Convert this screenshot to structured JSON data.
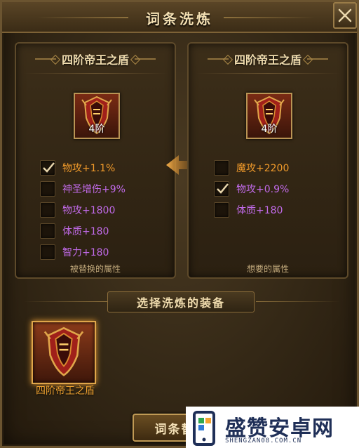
{
  "window": {
    "title": "词条洗炼"
  },
  "left_panel": {
    "title": "四阶帝王之盾",
    "item_level": "4阶",
    "attributes": [
      {
        "text": "物攻+1.1%",
        "color": "orange",
        "checked": true
      },
      {
        "text": "神圣增伤+9%",
        "color": "purple",
        "checked": false
      },
      {
        "text": "物攻+1800",
        "color": "purple",
        "checked": false
      },
      {
        "text": "体质+180",
        "color": "purple",
        "checked": false
      },
      {
        "text": "智力+180",
        "color": "purple",
        "checked": false
      }
    ],
    "footer": "被替换的属性"
  },
  "right_panel": {
    "title": "四阶帝王之盾",
    "item_level": "4阶",
    "attributes": [
      {
        "text": "魔攻+2200",
        "color": "orange",
        "checked": false
      },
      {
        "text": "物攻+0.9%",
        "color": "purple",
        "checked": true
      },
      {
        "text": "体质+180",
        "color": "purple",
        "checked": false
      }
    ],
    "footer": "想要的属性"
  },
  "select_section": {
    "title": "选择洗炼的装备",
    "equipment_name": "四阶帝王之盾"
  },
  "action_button": {
    "label": "词条替"
  },
  "watermark": {
    "name": "盛赞安卓网",
    "url": "SHENGZAN08.COM.CN"
  },
  "colors": {
    "orange": "#f09a2a",
    "purple": "#c06ae8",
    "gold_border": "#b99454"
  },
  "icons": {
    "close": "close-icon",
    "arrow": "arrow-left-icon",
    "check": "check-icon",
    "item": "shield-icon"
  }
}
